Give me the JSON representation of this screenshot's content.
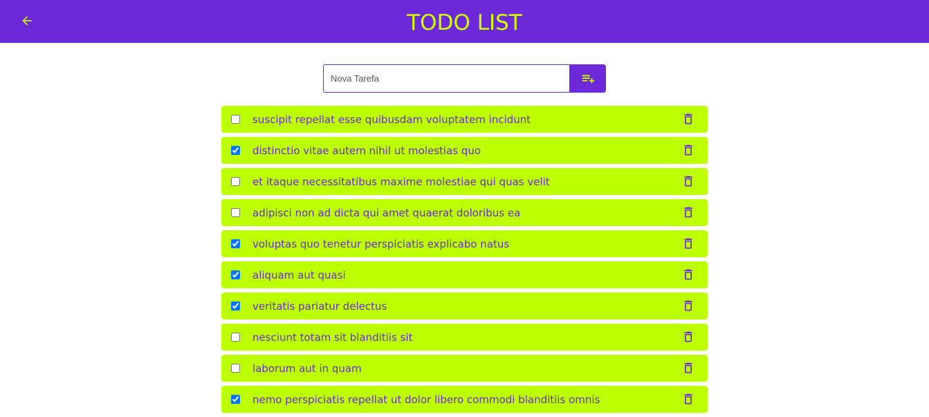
{
  "header": {
    "title": "TODO LIST",
    "back_icon": "arrow-left-icon"
  },
  "new_task": {
    "placeholder": "Nova Tarefa",
    "value": "",
    "add_icon": "playlist-add-icon"
  },
  "todos": [
    {
      "text": "suscipit repellat esse quibusdam voluptatem incidunt",
      "completed": false
    },
    {
      "text": "distinctio vitae autem nihil ut molestias quo",
      "completed": true
    },
    {
      "text": "et itaque necessitatibus maxime molestiae qui quas velit",
      "completed": false
    },
    {
      "text": "adipisci non ad dicta qui amet quaerat doloribus ea",
      "completed": false
    },
    {
      "text": "voluptas quo tenetur perspiciatis explicabo natus",
      "completed": true
    },
    {
      "text": "aliquam aut quasi",
      "completed": true
    },
    {
      "text": "veritatis pariatur delectus",
      "completed": true
    },
    {
      "text": "nesciunt totam sit blanditiis sit",
      "completed": false
    },
    {
      "text": "laborum aut in quam",
      "completed": false
    },
    {
      "text": "nemo perspiciatis repellat ut dolor libero commodi blanditiis omnis",
      "completed": true
    }
  ],
  "colors": {
    "primary": "#6d28d9",
    "accent": "#ccff00",
    "item_bg": "#bbff00"
  }
}
